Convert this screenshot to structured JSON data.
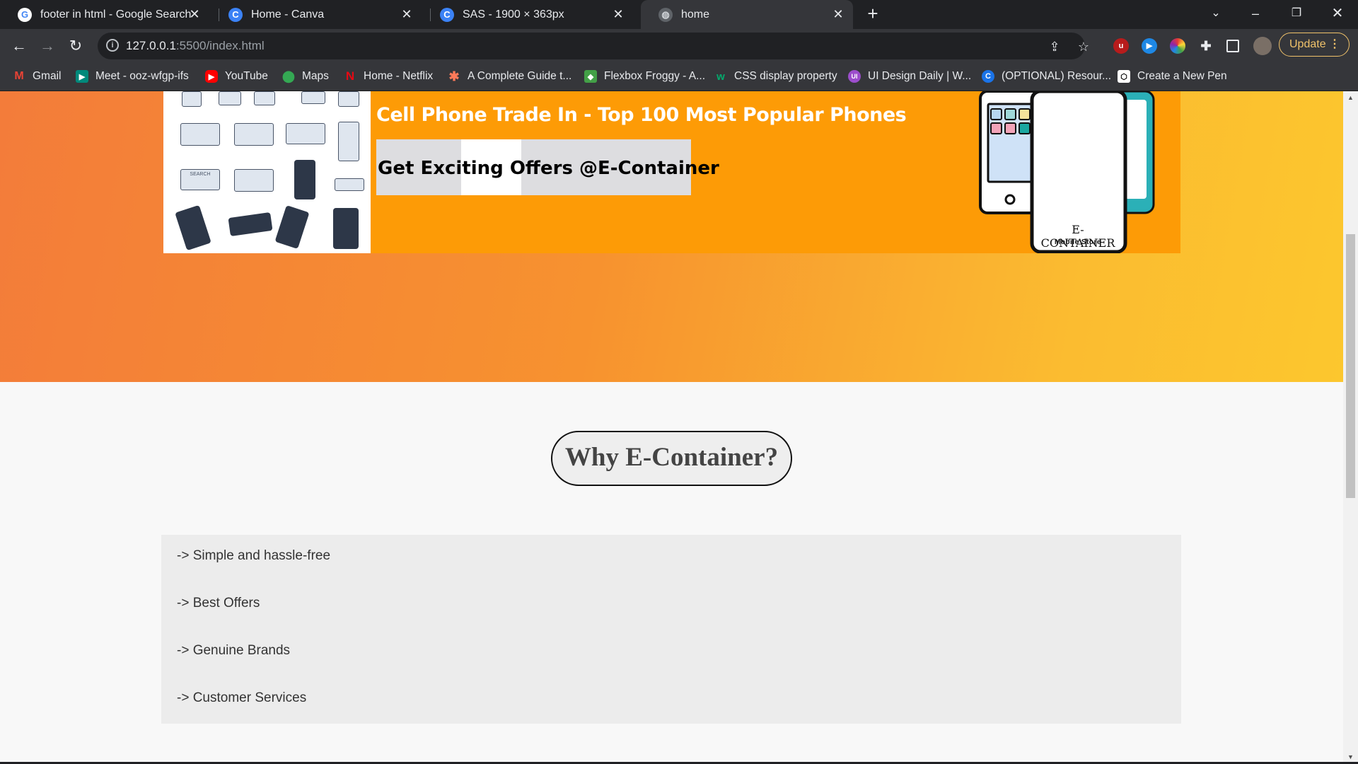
{
  "tabs": [
    {
      "title": "footer in html - Google Search",
      "icon": "google-icon"
    },
    {
      "title": "Home - Canva",
      "icon": "canva-icon"
    },
    {
      "title": "SAS - 1900 × 363px",
      "icon": "canva-icon"
    },
    {
      "title": "home",
      "icon": "globe-icon"
    }
  ],
  "address": {
    "host": "127.0.0.1",
    "rest": ":5500/index.html"
  },
  "update_label": "Update",
  "bookmarks": [
    {
      "label": "Gmail",
      "icon": "gmail-icon"
    },
    {
      "label": "Meet - ooz-wfgp-ifs",
      "icon": "meet-icon"
    },
    {
      "label": "YouTube",
      "icon": "youtube-icon"
    },
    {
      "label": "Maps",
      "icon": "maps-icon"
    },
    {
      "label": "Home - Netflix",
      "icon": "netflix-icon"
    },
    {
      "label": "A Complete Guide t...",
      "icon": "asterisk-icon"
    },
    {
      "label": "Flexbox Froggy - A...",
      "icon": "frog-icon"
    },
    {
      "label": "CSS display property",
      "icon": "w3-icon"
    },
    {
      "label": "UI Design Daily | W...",
      "icon": "ui-icon"
    },
    {
      "label": "(OPTIONAL) Resour...",
      "icon": "c-icon"
    },
    {
      "label": "Create a New Pen",
      "icon": "codepen-icon"
    }
  ],
  "banner": {
    "headline": "Cell Phone Trade In - Top 100 Most Popular Phones",
    "offer": "Get Exciting Offers @E-Container",
    "brand": "E-CONTAINER",
    "brand_sub": "Mobile Store",
    "search_thumb": "SEARCH"
  },
  "why": {
    "title": "Why E-Container?",
    "items": [
      "-> Simple and hassle-free",
      "-> Best Offers",
      "-> Genuine Brands",
      "-> Customer Services"
    ]
  },
  "colors": {
    "hero_start": "#f37c3a",
    "hero_end": "#fcc72e",
    "banner": "#fd9b06",
    "update": "#f0c26a"
  }
}
